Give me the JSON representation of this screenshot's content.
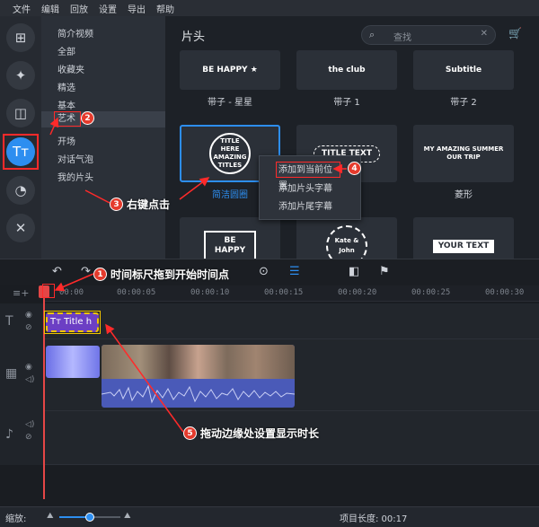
{
  "menubar": {
    "items": [
      "文件",
      "编辑",
      "回放",
      "设置",
      "导出",
      "帮助"
    ]
  },
  "rail": {
    "icons": [
      "add-file-icon",
      "magic-wand-icon",
      "transitions-icon",
      "titles-icon",
      "stickers-icon",
      "tools-icon"
    ]
  },
  "categories": {
    "items": [
      "简介视频",
      "全部",
      "收藏夹",
      "精选",
      "基本",
      "艺术",
      "开场",
      "对话气泡",
      "我的片头"
    ],
    "selected": "艺术"
  },
  "content": {
    "header": "片头",
    "search_placeholder": "查找",
    "tiles_row1": [
      {
        "thumb": "BE HAPPY ★",
        "label": "带子 - 星星"
      },
      {
        "thumb": "the club",
        "label": "带子 1"
      },
      {
        "thumb": "Subtitle",
        "label": "带子 2"
      }
    ],
    "tiles_row2": [
      {
        "thumb": "TITLE HERE\nAMAZING TITLES",
        "label": "简洁圆圈"
      },
      {
        "thumb": "TITLE TEXT",
        "label": ""
      },
      {
        "thumb": "MY AMAZING SUMMER\nOUR TRIP",
        "label": "菱形"
      }
    ],
    "tiles_row3": [
      {
        "thumb": "BE\nHAPPY"
      },
      {
        "thumb": "Kate & John"
      },
      {
        "thumb": "YOUR TEXT"
      }
    ]
  },
  "context_menu": {
    "items": [
      "添加到当前位置",
      "添加片头字幕",
      "添加片尾字幕"
    ]
  },
  "timeline": {
    "ruler_ticks": [
      "00:00",
      "00:00:05",
      "00:00:10",
      "00:00:15",
      "00:00:20",
      "00:00:25",
      "00:00:30"
    ],
    "title_clip": "Title h"
  },
  "status": {
    "zoom_label": "缩放:",
    "zoom_level": 0.5,
    "project_length": "项目长度: 00:17"
  },
  "annotations": {
    "a1": {
      "num": "1",
      "text": "时间标尺拖到开始时间点"
    },
    "a2": {
      "num": "2"
    },
    "a3": {
      "num": "3",
      "text": "右键点击"
    },
    "a4": {
      "num": "4"
    },
    "a5": {
      "num": "5",
      "text": "拖动边缘处设置显示时长"
    }
  },
  "colors": {
    "accent": "#2d8ef0",
    "annotation": "#e53b2d",
    "title_clip": "#6c3fc4"
  }
}
